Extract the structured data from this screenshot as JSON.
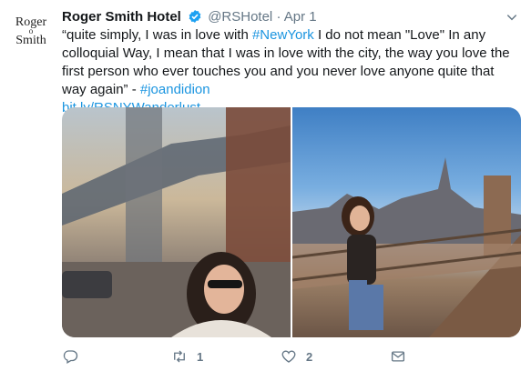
{
  "tweet": {
    "author_name": "Roger Smith Hotel",
    "handle": "@RSHotel",
    "separator": "·",
    "date": "Apr 1",
    "avatar_text": {
      "line1": "Roger",
      "line2": "Smith",
      "amp": "o"
    },
    "text_parts": {
      "p1": "“quite simply, I was in love with ",
      "hashtag1": "#NewYork",
      "p2": " I do not mean \"Love\" In any colloquial Way, I mean that I was in love with the city, the way you love the first person who ever touches you and you never love anyone quite that way again” - ",
      "hashtag2": "#joandidion",
      "link": "bit.ly/RSNYWanderlust…"
    },
    "counts": {
      "replies": "",
      "retweets": "1",
      "likes": "2"
    }
  },
  "colors": {
    "link": "#1b95e0",
    "verified": "#1da1f2",
    "muted": "#657786"
  },
  "icons": [
    "verified-badge-icon",
    "chevron-down-icon",
    "reply-icon",
    "retweet-icon",
    "like-icon",
    "direct-message-icon"
  ],
  "media": {
    "photos": [
      "photo-left-manhattan-bridge",
      "photo-right-brooklyn-bridge"
    ]
  }
}
